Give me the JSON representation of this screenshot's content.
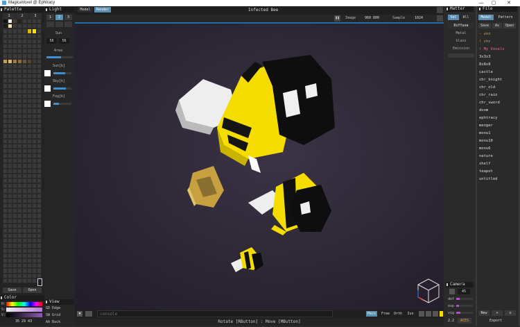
{
  "window": {
    "title": "MagicaVoxel @ Ephtracy",
    "minimize": "—",
    "maximize": "▢",
    "close": "✕"
  },
  "palette": {
    "header": "Palette",
    "tabs": [
      "1",
      "2",
      "3"
    ],
    "cells": [
      "#111111",
      "#eeeeee",
      "#4a3a2a",
      "#222222",
      "#3b3b3b",
      "#3b3b3b",
      "#3b3b3b",
      "#3b3b3b",
      "#1a1a1a",
      "#f3e0b0",
      "#3b3b3b",
      "#3b3b3b",
      "#3b3b3b",
      "#3b3b3b",
      "#3b3b3b",
      "#3b3b3b",
      "#3b3b3b",
      "#3b3b3b",
      "#3b3b3b",
      "#3b3b3b",
      "#3b3b3b",
      "#d8b800",
      "#ffe000",
      "#3b3b3b",
      "#3b3b3b",
      "#3b3b3b",
      "#3b3b3b",
      "#3b3b3b",
      "#3b3b3b",
      "#3b3b3b",
      "#3b3b3b",
      "#3b3b3b",
      "#3b3b3b",
      "#3b3b3b",
      "#3b3b3b",
      "#3b3b3b",
      "#3b3b3b",
      "#3b3b3b",
      "#3b3b3b",
      "#3b3b3b",
      "#3b3b3b",
      "#3b3b3b",
      "#3b3b3b",
      "#3b3b3b",
      "#3b3b3b",
      "#3b3b3b",
      "#3b3b3b",
      "#3b3b3b",
      "#3b3b3b",
      "#3b3b3b",
      "#3b3b3b",
      "#3b3b3b",
      "#3b3b3b",
      "#3b3b3b",
      "#3b3b3b",
      "#3b3b3b",
      "#3b3b3b",
      "#3b3b3b",
      "#3b3b3b",
      "#3b3b3b",
      "#3b3b3b",
      "#3b3b3b",
      "#3b3b3b",
      "#3b3b3b",
      "#c8a040",
      "#d8b860",
      "#a08030",
      "#8a7040",
      "#6a5a3a",
      "#504838",
      "#3b3b3b",
      "#3b3b3b"
    ],
    "save": "Save",
    "open": "Open"
  },
  "color": {
    "header": "Color",
    "h_label": "H:",
    "s_label": "S:",
    "v_label": "V:",
    "rgb_values": "35 29 43"
  },
  "light": {
    "header": "Light",
    "tabs": [
      "1",
      "2",
      "3"
    ],
    "sun_label": "Sun",
    "sun_values": [
      "56",
      "56"
    ],
    "area_label": "Area",
    "area_value": 0.55,
    "sun_k_label": "Sun[k]",
    "sun_k_value": 0.65,
    "sky_k_label": "Sky[k]",
    "sky_k_value": 0.7,
    "fog_label": "Fog[k]",
    "fog_value": 0.3
  },
  "view": {
    "header": "View",
    "items": [
      {
        "key": "GD",
        "label": "Edge"
      },
      {
        "key": "SW",
        "label": "Grid"
      },
      {
        "key": "AA",
        "label": "Back"
      }
    ]
  },
  "viewport": {
    "mode_tabs": [
      "Model",
      "Render"
    ],
    "active_mode": "Render",
    "scene_title": "Infected Bee",
    "image_label": "Image",
    "image_size": "960 800",
    "sample_label": "Sample",
    "sample_value": "1024",
    "console_placeholder": "console",
    "camera_modes": [
      "Pers",
      "Free",
      "Orth",
      "Iso"
    ],
    "active_camera_mode": "Pers",
    "hint": "Rotate [RButton] : Move [MButton]"
  },
  "matter": {
    "header": "Matter",
    "tabs": [
      "Sel",
      "All"
    ],
    "materials": [
      "Diffuse",
      "Metal",
      "Glass",
      "Emission"
    ]
  },
  "file": {
    "header": "File",
    "tabs": [
      "Model",
      "Pattern"
    ],
    "actions": [
      "Save",
      "As",
      "Open"
    ],
    "items": [
      {
        "name": "- vox",
        "style": "orange"
      },
      {
        "name": "! chr",
        "style": "orange"
      },
      {
        "name": "! My Voxels",
        "style": "pink"
      },
      {
        "name": "3x3x3",
        "style": ""
      },
      {
        "name": "8x8x8",
        "style": ""
      },
      {
        "name": "castle",
        "style": ""
      },
      {
        "name": "chr_knight",
        "style": ""
      },
      {
        "name": "chr_old",
        "style": ""
      },
      {
        "name": "chr_rain",
        "style": ""
      },
      {
        "name": "chr_sword",
        "style": ""
      },
      {
        "name": "doom",
        "style": ""
      },
      {
        "name": "ephtracy",
        "style": ""
      },
      {
        "name": "menger",
        "style": ""
      },
      {
        "name": "monu1",
        "style": ""
      },
      {
        "name": "monu10",
        "style": ""
      },
      {
        "name": "monu6",
        "style": ""
      },
      {
        "name": "nature",
        "style": ""
      },
      {
        "name": "shelf",
        "style": ""
      },
      {
        "name": "teapot",
        "style": ""
      },
      {
        "name": "untitled",
        "style": ""
      }
    ],
    "new_label": "New",
    "plus_label": "+",
    "x_label": "x",
    "export_label": "Export"
  },
  "camera": {
    "header": "Camera",
    "fov_value": "45",
    "dof_label": "dof",
    "exp_label": "exp",
    "vig_label": "vig",
    "gamma_value": "2.2",
    "aces_label": "ACES"
  },
  "colors": {
    "accent": "#5b8fb0",
    "orange": "#e6a23c",
    "pink": "#e46aa1",
    "bee_yellow": "#f5dd00"
  }
}
